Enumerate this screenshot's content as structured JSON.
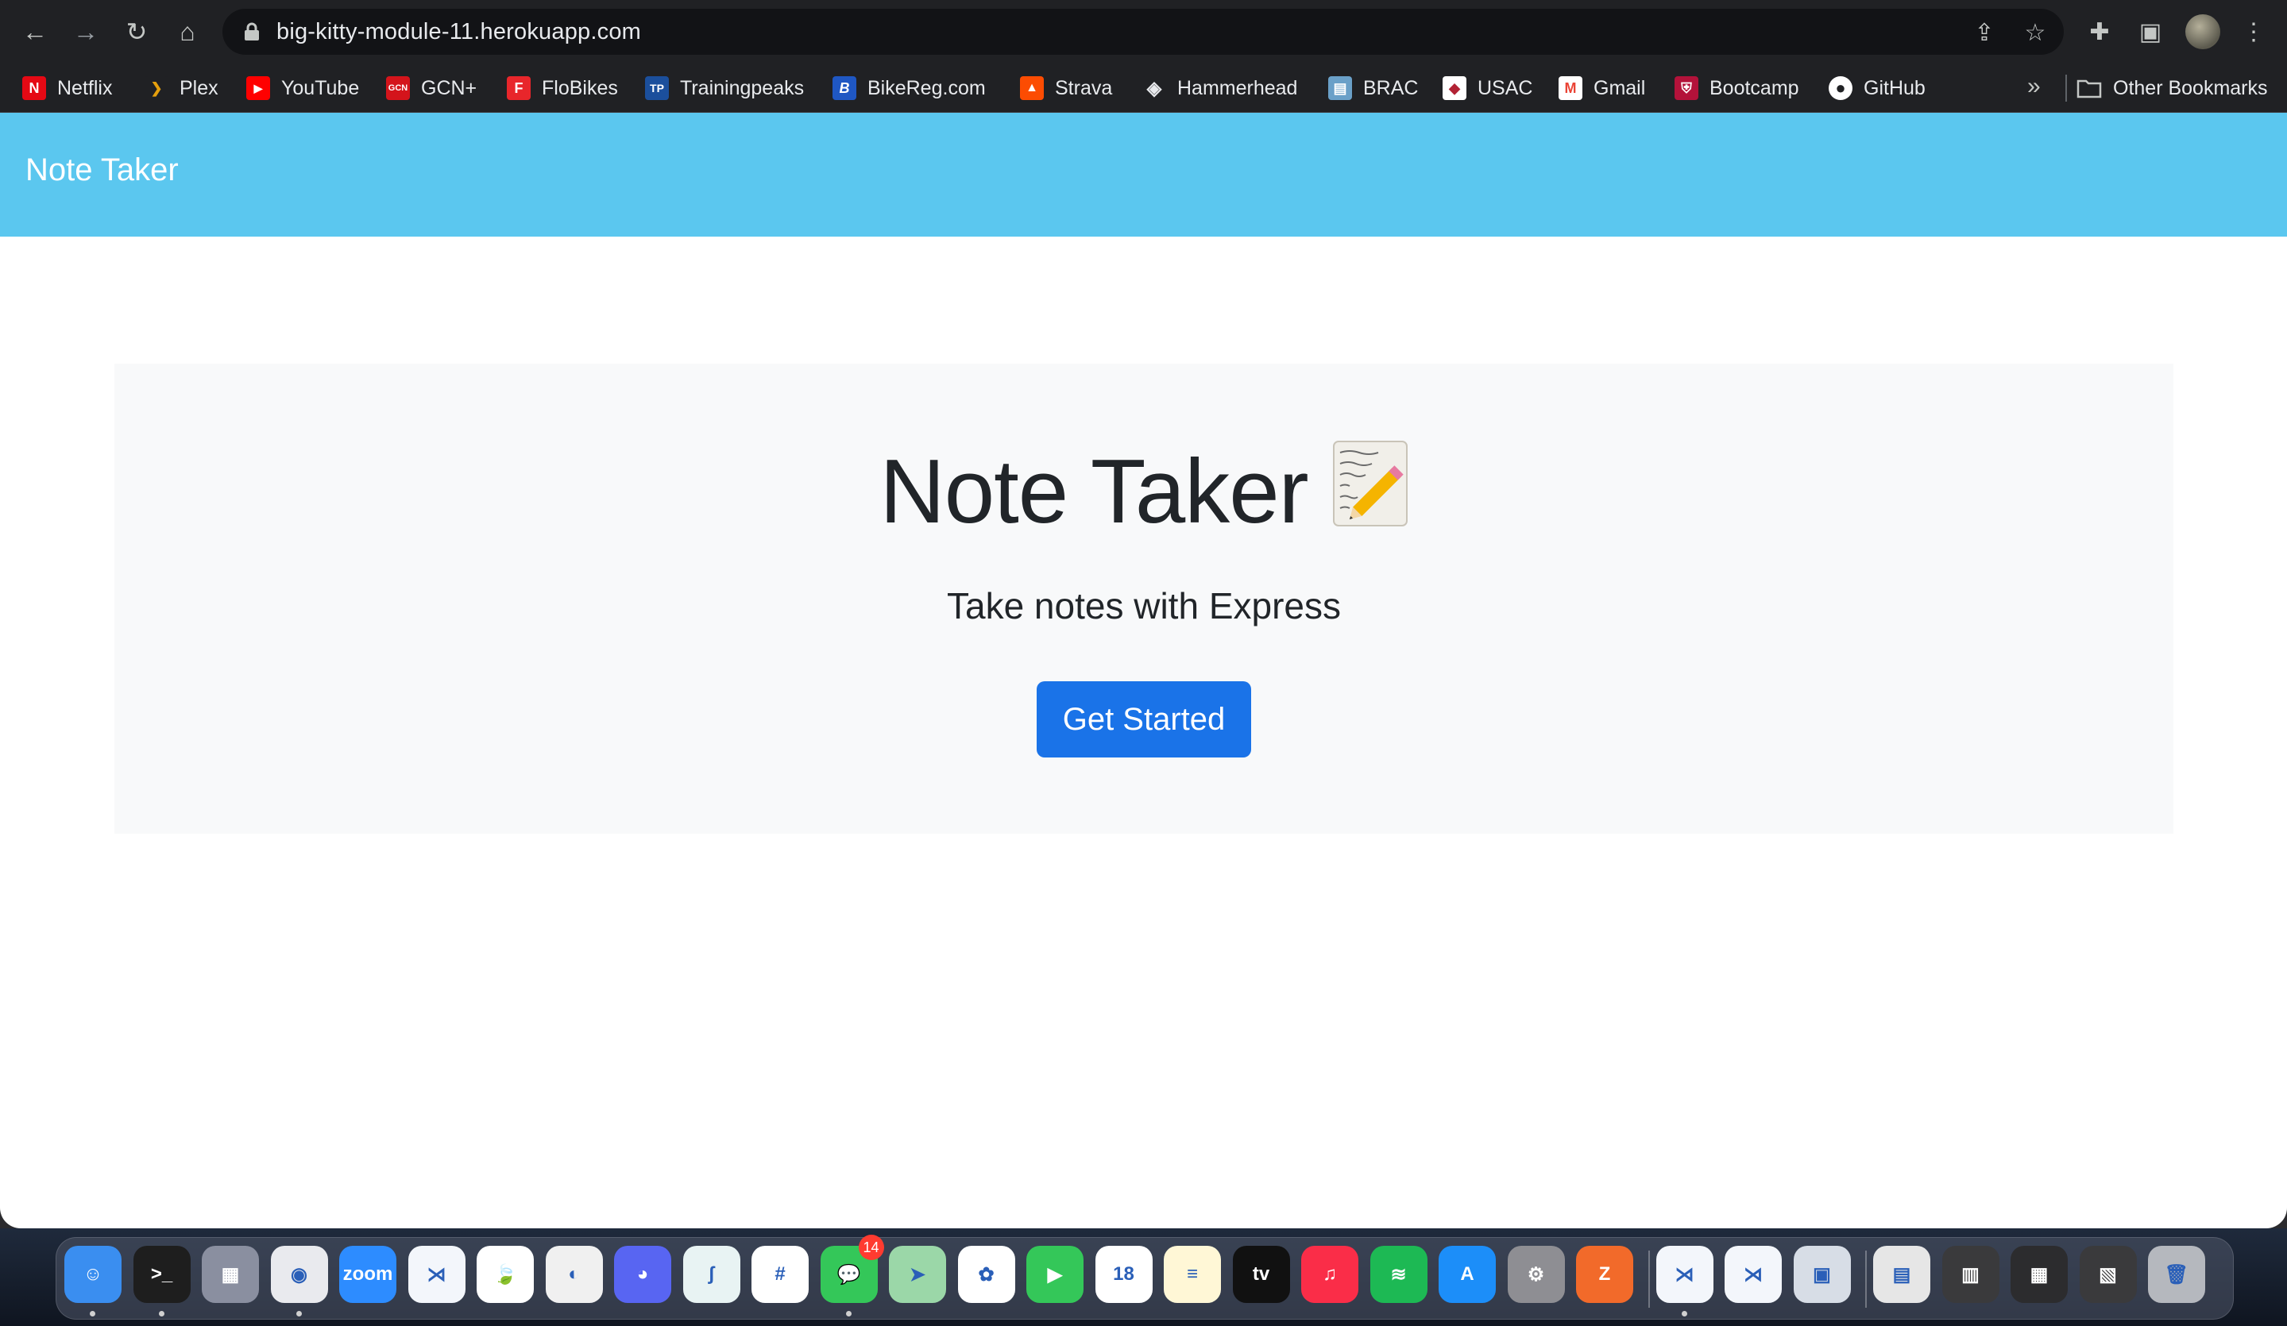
{
  "browser": {
    "url": "big-kitty-module-11.herokuapp.com",
    "bookmarks": [
      {
        "label": "Netflix",
        "icon": "netflix-icon",
        "color": "#e50914",
        "glyph": "N"
      },
      {
        "label": "Plex",
        "icon": "plex-icon",
        "color": "#e5a00d",
        "glyph": "❯"
      },
      {
        "label": "YouTube",
        "icon": "youtube-icon",
        "color": "#ff0000",
        "glyph": "▶"
      },
      {
        "label": "GCN+",
        "icon": "gcn-icon",
        "color": "#d4141b",
        "glyph": "GCN"
      },
      {
        "label": "FloBikes",
        "icon": "flobikes-icon",
        "color": "#e8262b",
        "glyph": "F"
      },
      {
        "label": "Trainingpeaks",
        "icon": "trainingpeaks-icon",
        "color": "#1b4f9c",
        "glyph": "TP"
      },
      {
        "label": "BikeReg.com",
        "icon": "bikereg-icon",
        "color": "#1f57c3",
        "glyph": "B"
      },
      {
        "label": "Strava",
        "icon": "strava-icon",
        "color": "#fc4c02",
        "glyph": "▲"
      },
      {
        "label": "Hammerhead",
        "icon": "hammerhead-icon",
        "color": "#202124",
        "glyph": "◈"
      },
      {
        "label": "BRAC",
        "icon": "brac-icon",
        "color": "#6aa0c8",
        "glyph": "▤"
      },
      {
        "label": "USAC",
        "icon": "usac-icon",
        "color": "#b22234",
        "glyph": "◆"
      },
      {
        "label": "Gmail",
        "icon": "gmail-icon",
        "color": "#ea4335",
        "glyph": "M"
      },
      {
        "label": "Bootcamp",
        "icon": "bootcamp-icon",
        "color": "#b3123a",
        "glyph": "⛨"
      },
      {
        "label": "GitHub",
        "icon": "github-icon",
        "color": "#202124",
        "glyph": "●"
      }
    ],
    "more": "»",
    "other_bookmarks": "Other Bookmarks"
  },
  "navbar": {
    "brand": "Note Taker"
  },
  "hero": {
    "title": "Note Taker",
    "subtitle": "Take notes with Express",
    "cta_label": "Get Started"
  },
  "dock": {
    "apps": [
      {
        "name": "finder-icon",
        "color": "#3a8ef0",
        "glyph": "☺",
        "dot": true
      },
      {
        "name": "terminal-icon",
        "color": "#1e1e1e",
        "glyph": ">_",
        "dot": true
      },
      {
        "name": "launchpad-icon",
        "color": "#8a8fa0",
        "glyph": "▦",
        "dot": false
      },
      {
        "name": "chrome-icon",
        "color": "#e9eaee",
        "glyph": "◉",
        "dot": true
      },
      {
        "name": "zoom-icon",
        "color": "#2d8cff",
        "glyph": "zoom",
        "dot": false
      },
      {
        "name": "vscode-icon",
        "color": "#f3f6fb",
        "glyph": "⋊",
        "dot": false
      },
      {
        "name": "mongodb-icon",
        "color": "#ffffff",
        "glyph": "🍃",
        "dot": false
      },
      {
        "name": "nightowl-icon",
        "color": "#f0f0f0",
        "glyph": "◐",
        "dot": false
      },
      {
        "name": "discord-icon",
        "color": "#5865f2",
        "glyph": "◕",
        "dot": false
      },
      {
        "name": "surfshark-icon",
        "color": "#e8f3f3",
        "glyph": "ʃ",
        "dot": false
      },
      {
        "name": "slack-icon",
        "color": "#ffffff",
        "glyph": "#",
        "dot": false
      },
      {
        "name": "messages-icon",
        "color": "#34c759",
        "glyph": "💬",
        "dot": true,
        "badge": "14"
      },
      {
        "name": "maps-icon",
        "color": "#9bd7a8",
        "glyph": "➤",
        "dot": false
      },
      {
        "name": "photos-icon",
        "color": "#ffffff",
        "glyph": "✿",
        "dot": false
      },
      {
        "name": "facetime-icon",
        "color": "#34c759",
        "glyph": "▶",
        "dot": false
      },
      {
        "name": "calendar-icon",
        "color": "#ffffff",
        "glyph": "18",
        "dot": false
      },
      {
        "name": "notes-icon",
        "color": "#fff7d6",
        "glyph": "≡",
        "dot": false
      },
      {
        "name": "appletv-icon",
        "color": "#111111",
        "glyph": "tv",
        "dot": false
      },
      {
        "name": "music-icon",
        "color": "#fa2d48",
        "glyph": "♫",
        "dot": false
      },
      {
        "name": "spotify-icon",
        "color": "#1db954",
        "glyph": "≋",
        "dot": false
      },
      {
        "name": "appstore-icon",
        "color": "#1c8ef9",
        "glyph": "A",
        "dot": false
      },
      {
        "name": "system-preferences-icon",
        "color": "#8e8e93",
        "glyph": "⚙",
        "dot": false
      },
      {
        "name": "zotero-icon",
        "color": "#f26a2a",
        "glyph": "Z",
        "dot": false
      }
    ],
    "recent": [
      {
        "name": "vscode-recent-icon",
        "color": "#f3f6fb",
        "glyph": "⋊",
        "dot": true
      },
      {
        "name": "vscode-insiders-icon",
        "color": "#f3f6fb",
        "glyph": "⋊",
        "dot": false
      },
      {
        "name": "preview-icon",
        "color": "#d7dde6",
        "glyph": "▣",
        "dot": false
      }
    ],
    "stacks": [
      {
        "name": "documents-stack-icon",
        "color": "#e6e6e6",
        "glyph": "▤"
      },
      {
        "name": "screenshots-stack-icon",
        "color": "#3a3a3c",
        "glyph": "▥"
      },
      {
        "name": "windows-stack-icon",
        "color": "#2c2c2e",
        "glyph": "▦"
      },
      {
        "name": "downloads-stack-icon",
        "color": "#3a3a3c",
        "glyph": "▧"
      },
      {
        "name": "trash-icon",
        "color": "#b5b8be",
        "glyph": "🗑"
      }
    ]
  }
}
